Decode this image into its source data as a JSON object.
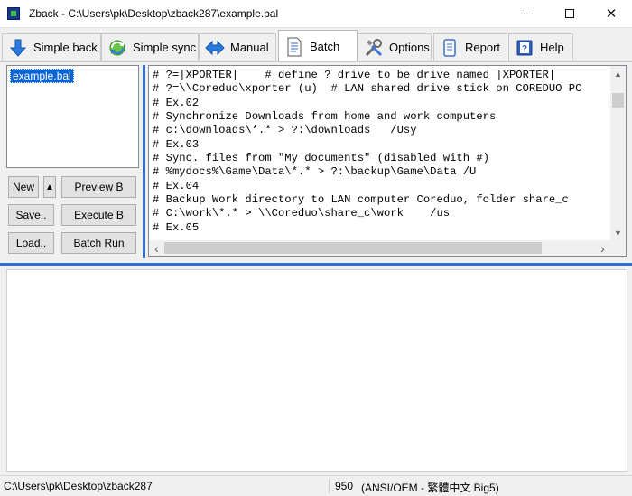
{
  "window": {
    "title": "Zback - C:\\Users\\pk\\Desktop\\zback287\\example.bal",
    "minimize_icon": "minimize-icon",
    "maximize_icon": "maximize-icon",
    "close_glyph": "✕"
  },
  "tabs": [
    {
      "label": "Simple back",
      "icon": "download-arrow-icon",
      "active": false
    },
    {
      "label": "Simple sync",
      "icon": "sync-icon",
      "active": false
    },
    {
      "label": "Manual",
      "icon": "left-right-arrow-icon",
      "active": false
    },
    {
      "label": "Batch",
      "icon": "document-icon",
      "active": true
    },
    {
      "label": "Options",
      "icon": "tools-icon",
      "active": false
    },
    {
      "label": "Report",
      "icon": "scroll-icon",
      "active": false
    },
    {
      "label": "Help",
      "icon": "help-book-icon",
      "active": false
    }
  ],
  "batch_files": [
    "example.bal"
  ],
  "buttons": {
    "new": "New",
    "up_arrow": "▲",
    "preview": "Preview B",
    "save": "Save..",
    "execute": "Execute B",
    "load": "Load..",
    "batch_run": "Batch Run"
  },
  "editor_lines": [
    "# ?=|XPORTER|    # define ? drive to be drive named |XPORTER|",
    "# ?=\\\\Coreduo\\xporter (u)  # LAN shared drive stick on COREDUO PC",
    "# Ex.02",
    "# Synchronize Downloads from home and work computers",
    "# c:\\downloads\\*.* > ?:\\downloads   /Usy",
    "# Ex.03",
    "# Sync. files from \"My documents\" (disabled with #)",
    "# %mydocs%\\Game\\Data\\*.* > ?:\\backup\\Game\\Data /U",
    "# Ex.04",
    "# Backup Work directory to LAN computer Coreduo, folder share_c",
    "# C:\\work\\*.* > \\\\Coreduo\\share_c\\work    /us",
    "# Ex.05"
  ],
  "scrollbar": {
    "up": "▲",
    "down": "▼",
    "left": "‹",
    "right": "›"
  },
  "status": {
    "path": "C:\\Users\\pk\\Desktop\\zback287",
    "count": "950",
    "encoding": "(ANSI/OEM - 繁體中文 Big5)"
  }
}
